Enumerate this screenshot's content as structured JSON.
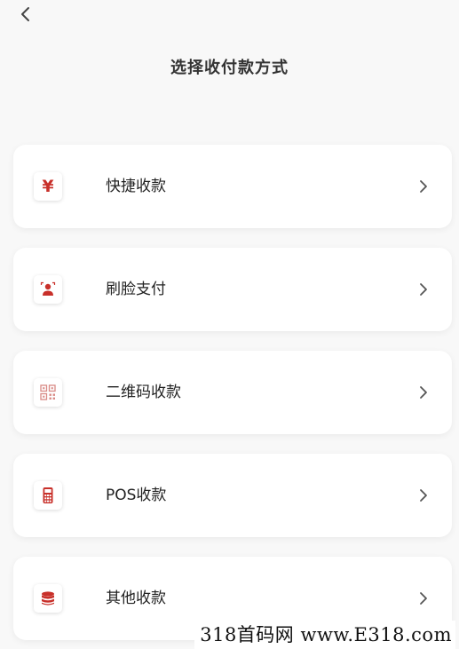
{
  "header": {
    "title": "选择收付款方式",
    "back_icon": "chevron-left-icon"
  },
  "accent_color": "#c8302a",
  "options": [
    {
      "label": "快捷收款",
      "icon": "yen-icon"
    },
    {
      "label": "刷脸支付",
      "icon": "face-pay-icon"
    },
    {
      "label": "二维码收款",
      "icon": "qr-code-icon"
    },
    {
      "label": "POS收款",
      "icon": "pos-terminal-icon"
    },
    {
      "label": "其他收款",
      "icon": "coin-stack-icon"
    }
  ],
  "watermark": "318首码网 www.E318.com"
}
